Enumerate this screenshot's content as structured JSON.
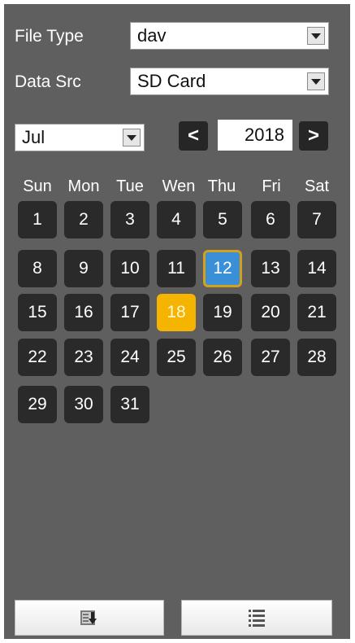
{
  "filters": {
    "file_type_label": "File Type",
    "file_type_value": "dav",
    "data_src_label": "Data Src",
    "data_src_value": "SD Card"
  },
  "calendar": {
    "month": "Jul",
    "year": "2018",
    "prev_symbol": "<",
    "next_symbol": ">",
    "weekdays": [
      "Sun",
      "Mon",
      "Tue",
      "Wen",
      "Thu",
      "Fri",
      "Sat"
    ],
    "first_weekday_index": 0,
    "days_in_month": 31,
    "today": 12,
    "selected": 18
  },
  "buttons": {
    "download_icon": "download-icon",
    "list_icon": "list-icon"
  },
  "colors": {
    "panel_bg": "#5f5f5f",
    "day_bg": "#2a2a2a",
    "today_fill": "#3a8fd6",
    "today_border": "#d4a21a",
    "selected_fill": "#f5b400"
  }
}
